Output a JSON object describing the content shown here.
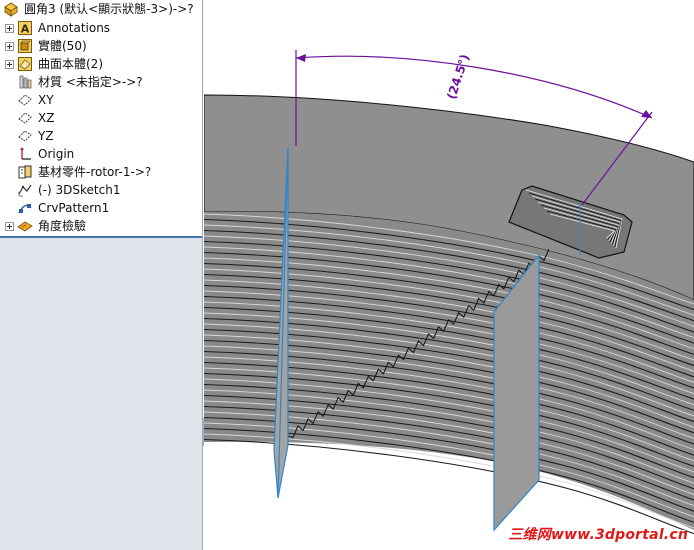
{
  "feature_tree": {
    "root": {
      "label": "圓角3 (默认<顯示狀態-3>)->?",
      "icon": "part-icon"
    },
    "items": [
      {
        "label": "Annotations",
        "icon": "annotations-icon",
        "expandable": true
      },
      {
        "label": "實體(50)",
        "icon": "solid-bodies-icon",
        "expandable": true
      },
      {
        "label": "曲面本體(2)",
        "icon": "surface-bodies-icon",
        "expandable": true
      },
      {
        "label": "材質 <未指定>->?",
        "icon": "material-icon",
        "expandable": false
      },
      {
        "label": "XY",
        "icon": "plane-icon",
        "expandable": false
      },
      {
        "label": "XZ",
        "icon": "plane-icon",
        "expandable": false
      },
      {
        "label": "YZ",
        "icon": "plane-icon",
        "expandable": false
      },
      {
        "label": "Origin",
        "icon": "origin-icon",
        "expandable": false
      },
      {
        "label": "基材零件-rotor-1->?",
        "icon": "base-part-icon",
        "expandable": false
      },
      {
        "label": "(-) 3DSketch1",
        "icon": "3d-sketch-icon",
        "expandable": false
      },
      {
        "label": "CrvPattern1",
        "icon": "curve-pattern-icon",
        "expandable": false
      },
      {
        "label": "角度檢驗",
        "icon": "angle-check-icon",
        "expandable": true
      }
    ]
  },
  "viewport": {
    "dimension_label": "(24.5°)",
    "colors": {
      "body_gray": "#8f8f8f",
      "body_dark": "#6f6f6f",
      "edge_black": "#111111",
      "dimension_purple": "#6b0f9a",
      "plane_blue": "#2f86c8",
      "plane_fill": "#9a9a9a"
    }
  },
  "watermark": {
    "text": "三维网www.3dportal.cn"
  }
}
